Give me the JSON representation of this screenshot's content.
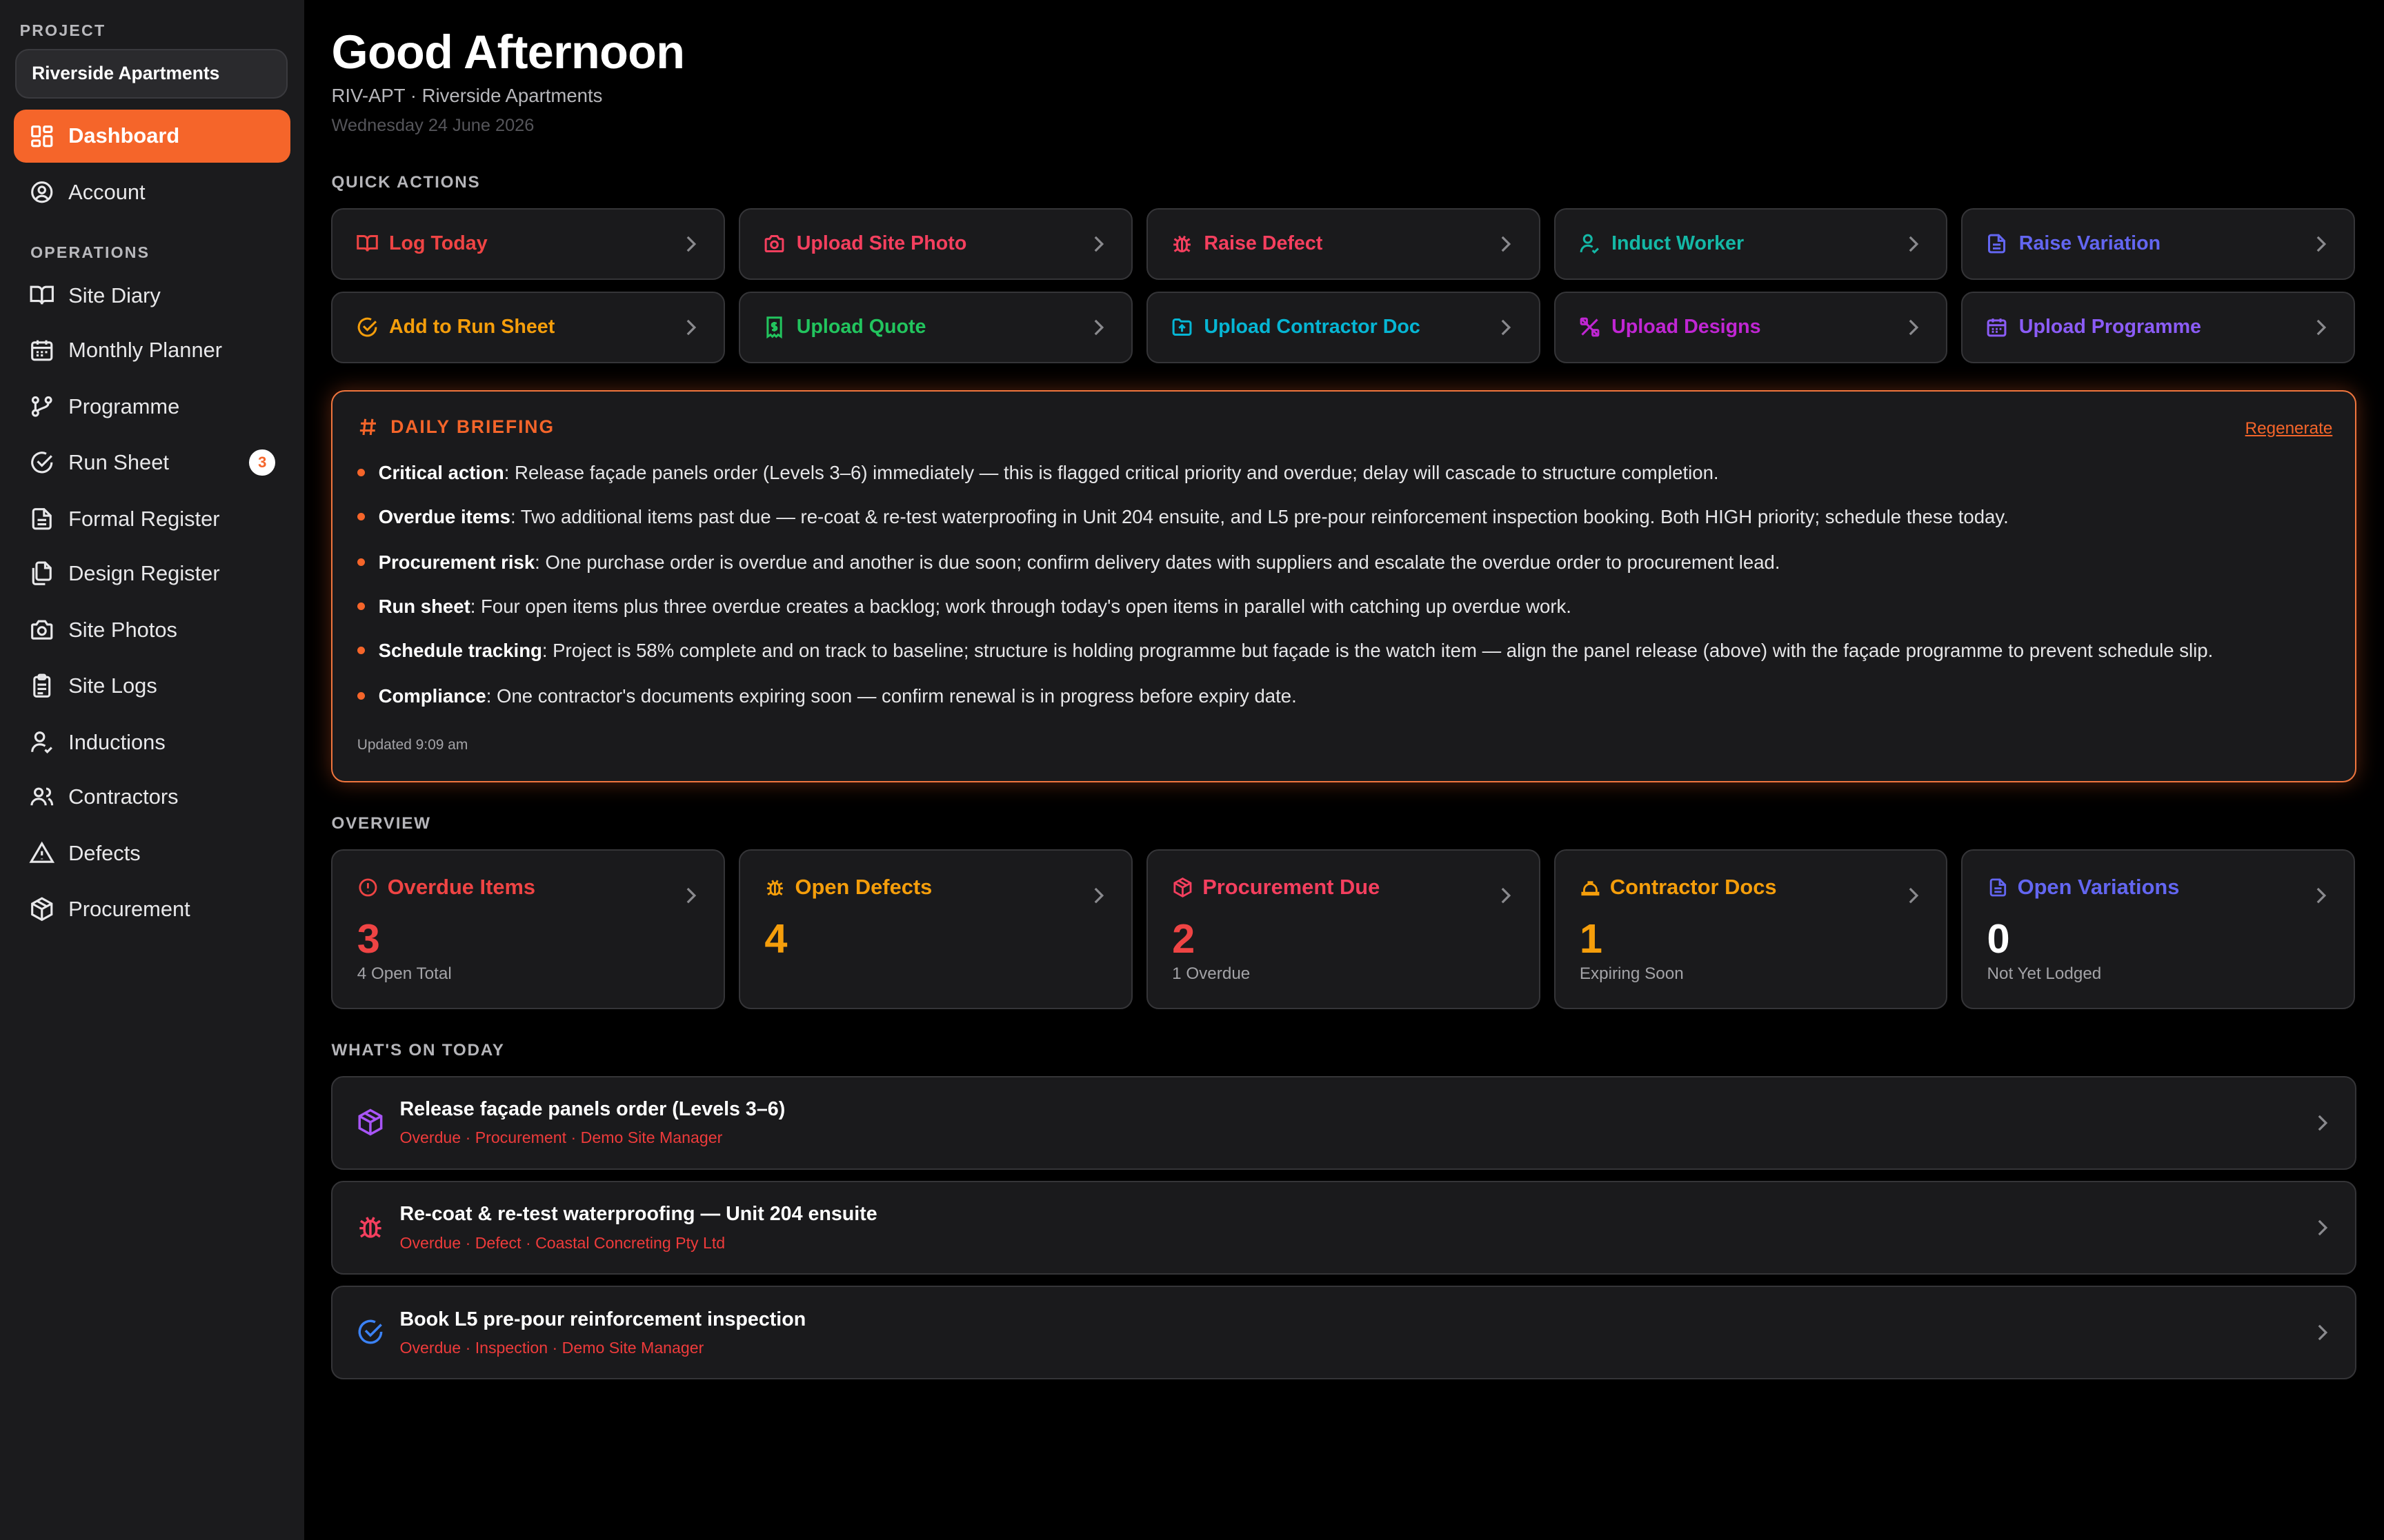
{
  "sidebar": {
    "project_label": "PROJECT",
    "project_name": "Riverside Apartments",
    "operations_label": "OPERATIONS",
    "items": [
      {
        "label": "Dashboard"
      },
      {
        "label": "Account"
      },
      {
        "label": "Site Diary"
      },
      {
        "label": "Monthly Planner"
      },
      {
        "label": "Programme"
      },
      {
        "label": "Run Sheet",
        "badge": "3"
      },
      {
        "label": "Formal Register"
      },
      {
        "label": "Design Register"
      },
      {
        "label": "Site Photos"
      },
      {
        "label": "Site Logs"
      },
      {
        "label": "Inductions"
      },
      {
        "label": "Contractors"
      },
      {
        "label": "Defects"
      },
      {
        "label": "Procurement"
      }
    ]
  },
  "header": {
    "greeting": "Good Afternoon",
    "subtitle": "RIV-APT · Riverside Apartments",
    "date": "Wednesday 24 June 2026"
  },
  "quick_actions": {
    "label": "QUICK ACTIONS",
    "items": [
      {
        "label": "Log Today",
        "color": "#ef4444",
        "icon": "book-icon"
      },
      {
        "label": "Upload Site Photo",
        "color": "#f43f5e",
        "icon": "camera-icon"
      },
      {
        "label": "Raise Defect",
        "color": "#f43f5e",
        "icon": "bug-icon"
      },
      {
        "label": "Induct Worker",
        "color": "#14b8a6",
        "icon": "user-check-icon"
      },
      {
        "label": "Raise Variation",
        "color": "#6366f1",
        "icon": "document-icon"
      },
      {
        "label": "Add to Run Sheet",
        "color": "#f59e0b",
        "icon": "check-circle-icon"
      },
      {
        "label": "Upload Quote",
        "color": "#22c55e",
        "icon": "receipt-icon"
      },
      {
        "label": "Upload Contractor Doc",
        "color": "#06b6d4",
        "icon": "folder-upload-icon"
      },
      {
        "label": "Upload Designs",
        "color": "#c026d3",
        "icon": "design-tools-icon"
      },
      {
        "label": "Upload Programme",
        "color": "#8b5cf6",
        "icon": "calendar-icon"
      }
    ]
  },
  "briefing": {
    "label": "DAILY BRIEFING",
    "regenerate": "Regenerate",
    "updated": "Updated 9:09 am",
    "items": [
      {
        "key": "Critical action",
        "text": ": Release façade panels order (Levels 3–6) immediately — this is flagged critical priority and overdue; delay will cascade to structure completion."
      },
      {
        "key": "Overdue items",
        "text": ": Two additional items past due — re-coat & re-test waterproofing in Unit 204 ensuite, and L5 pre-pour reinforcement inspection booking. Both HIGH priority; schedule these today."
      },
      {
        "key": "Procurement risk",
        "text": ": One purchase order is overdue and another is due soon; confirm delivery dates with suppliers and escalate the overdue order to procurement lead."
      },
      {
        "key": "Run sheet",
        "text": ": Four open items plus three overdue creates a backlog; work through today's open items in parallel with catching up overdue work."
      },
      {
        "key": "Schedule tracking",
        "text": ": Project is 58% complete and on track to baseline; structure is holding programme but façade is the watch item — align the panel release (above) with the façade programme to prevent schedule slip."
      },
      {
        "key": "Compliance",
        "text": ": One contractor's documents expiring soon — confirm renewal is in progress before expiry date."
      }
    ]
  },
  "overview": {
    "label": "OVERVIEW",
    "cards": [
      {
        "title": "Overdue Items",
        "value": "3",
        "sub": "4 Open Total",
        "color": "#ef4444",
        "value_color": "#ef4444",
        "icon": "alert-circle-icon"
      },
      {
        "title": "Open Defects",
        "value": "4",
        "sub": "",
        "color": "#f59e0b",
        "value_color": "#f59e0b",
        "icon": "bug-icon"
      },
      {
        "title": "Procurement Due",
        "value": "2",
        "sub": "1 Overdue",
        "color": "#f43f5e",
        "value_color": "#ef4444",
        "icon": "package-icon"
      },
      {
        "title": "Contractor Docs",
        "value": "1",
        "sub": "Expiring Soon",
        "color": "#f59e0b",
        "value_color": "#f59e0b",
        "icon": "hard-hat-icon"
      },
      {
        "title": "Open Variations",
        "value": "0",
        "sub": "Not Yet Lodged",
        "color": "#6366f1",
        "value_color": "#ffffff",
        "icon": "document-icon"
      }
    ]
  },
  "today": {
    "label": "WHAT'S ON TODAY",
    "items": [
      {
        "title": "Release façade panels order (Levels 3–6)",
        "meta": "Overdue · Procurement · Demo Site Manager",
        "icon": "package-icon",
        "color": "#a855f7"
      },
      {
        "title": "Re-coat & re-test waterproofing — Unit 204 ensuite",
        "meta": "Overdue · Defect · Coastal Concreting Pty Ltd",
        "icon": "bug-icon",
        "color": "#f43f5e"
      },
      {
        "title": "Book L5 pre-pour reinforcement inspection",
        "meta": "Overdue · Inspection · Demo Site Manager",
        "icon": "check-circle-icon",
        "color": "#3b82f6"
      }
    ]
  }
}
